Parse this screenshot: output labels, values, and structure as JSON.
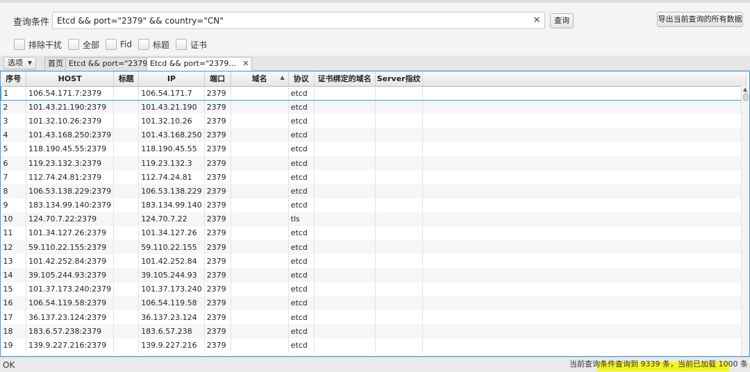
{
  "query": {
    "label": "查询条件",
    "value": "Etcd && port=\"2379\" && country=\"CN\"",
    "clear_icon": "close-icon",
    "query_button": "查询",
    "export_button": "导出当前查询的所有数据"
  },
  "filters": [
    {
      "label": "排除干扰",
      "checked": false
    },
    {
      "label": "全部",
      "checked": false
    },
    {
      "label": "Fid",
      "checked": false
    },
    {
      "label": "标题",
      "checked": false
    },
    {
      "label": "证书",
      "checked": false
    }
  ],
  "tabbar": {
    "options_label": "选项",
    "tabs": [
      {
        "label": "首页"
      },
      {
        "label": "Etcd && port=\"2379\""
      },
      {
        "label": "Etcd && port=\"2379...",
        "active": true
      }
    ]
  },
  "table": {
    "columns": [
      "序号",
      "HOST",
      "标题",
      "IP",
      "端口",
      "域名",
      "协议",
      "证书绑定的域名",
      "Server指纹"
    ],
    "sorted_column": "域名",
    "rows": [
      [
        "1",
        "106.54.171.7:2379",
        "",
        "106.54.171.7",
        "2379",
        "",
        "etcd",
        "",
        ""
      ],
      [
        "2",
        "101.43.21.190:2379",
        "",
        "101.43.21.190",
        "2379",
        "",
        "etcd",
        "",
        ""
      ],
      [
        "3",
        "101.32.10.26:2379",
        "",
        "101.32.10.26",
        "2379",
        "",
        "etcd",
        "",
        ""
      ],
      [
        "4",
        "101.43.168.250:2379",
        "",
        "101.43.168.250",
        "2379",
        "",
        "etcd",
        "",
        ""
      ],
      [
        "5",
        "118.190.45.55:2379",
        "",
        "118.190.45.55",
        "2379",
        "",
        "etcd",
        "",
        ""
      ],
      [
        "6",
        "119.23.132.3:2379",
        "",
        "119.23.132.3",
        "2379",
        "",
        "etcd",
        "",
        ""
      ],
      [
        "7",
        "112.74.24.81:2379",
        "",
        "112.74.24.81",
        "2379",
        "",
        "etcd",
        "",
        ""
      ],
      [
        "8",
        "106.53.138.229:2379",
        "",
        "106.53.138.229",
        "2379",
        "",
        "etcd",
        "",
        ""
      ],
      [
        "9",
        "183.134.99.140:2379",
        "",
        "183.134.99.140",
        "2379",
        "",
        "etcd",
        "",
        ""
      ],
      [
        "10",
        "124.70.7.22:2379",
        "",
        "124.70.7.22",
        "2379",
        "",
        "tls",
        "",
        ""
      ],
      [
        "11",
        "101.34.127.26:2379",
        "",
        "101.34.127.26",
        "2379",
        "",
        "etcd",
        "",
        ""
      ],
      [
        "12",
        "59.110.22.155:2379",
        "",
        "59.110.22.155",
        "2379",
        "",
        "etcd",
        "",
        ""
      ],
      [
        "13",
        "101.42.252.84:2379",
        "",
        "101.42.252.84",
        "2379",
        "",
        "etcd",
        "",
        ""
      ],
      [
        "14",
        "39.105.244.93:2379",
        "",
        "39.105.244.93",
        "2379",
        "",
        "etcd",
        "",
        ""
      ],
      [
        "15",
        "101.37.173.240:2379",
        "",
        "101.37.173.240",
        "2379",
        "",
        "etcd",
        "",
        ""
      ],
      [
        "16",
        "106.54.119.58:2379",
        "",
        "106.54.119.58",
        "2379",
        "",
        "etcd",
        "",
        ""
      ],
      [
        "17",
        "36.137.23.124:2379",
        "",
        "36.137.23.124",
        "2379",
        "",
        "etcd",
        "",
        ""
      ],
      [
        "18",
        "183.6.57.238:2379",
        "",
        "183.6.57.238",
        "2379",
        "",
        "etcd",
        "",
        ""
      ],
      [
        "19",
        "139.9.227.216:2379",
        "",
        "139.9.227.216",
        "2379",
        "",
        "etcd",
        "",
        ""
      ]
    ]
  },
  "status": {
    "left": "OK",
    "right": "当前查询条件查询到 9339 条，当前已加载 1000 条",
    "highlight_color": "#f5f51e"
  },
  "colors": {
    "selection_border": "#3c9ad6"
  }
}
